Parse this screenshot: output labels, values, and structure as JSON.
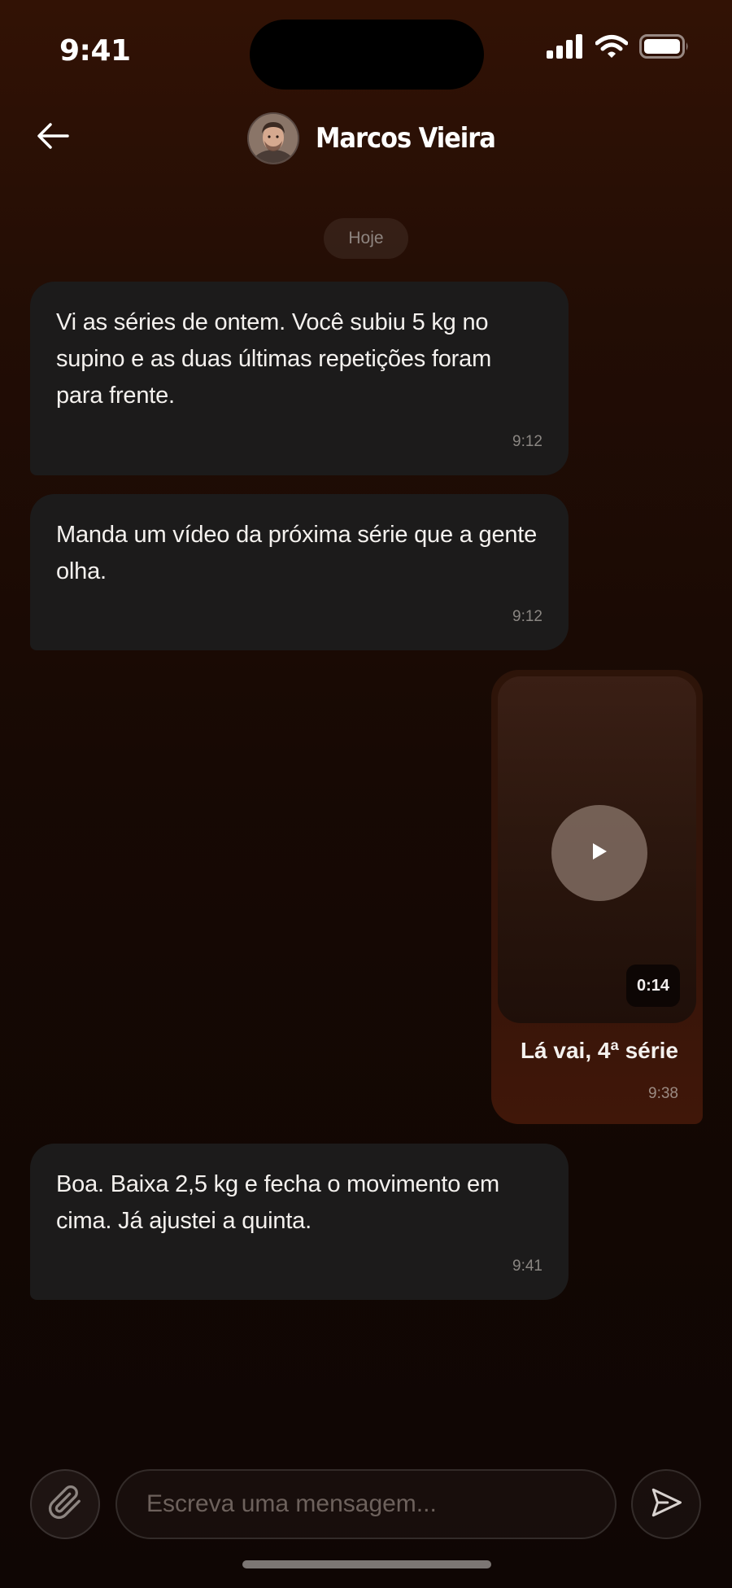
{
  "status_bar": {
    "time": "9:41"
  },
  "header": {
    "contact_name": "Marcos Vieira"
  },
  "chat": {
    "date_label": "Hoje",
    "messages": [
      {
        "direction": "incoming",
        "text": "Vi as séries de ontem. Você subiu 5 kg no supino e as duas últimas repetições foram para frente.",
        "time": "9:12"
      },
      {
        "direction": "incoming",
        "text": "Manda um vídeo da próxima série que a gente olha.",
        "time": "9:12"
      },
      {
        "direction": "outgoing",
        "type": "video",
        "duration": "0:14",
        "caption": "Lá vai, 4ª série",
        "time": "9:38"
      },
      {
        "direction": "incoming",
        "text": "Boa. Baixa 2,5 kg e fecha o movimento em cima. Já ajustei a quinta.",
        "time": "9:41"
      }
    ]
  },
  "composer": {
    "placeholder": "Escreva uma mensagem..."
  },
  "icons": {
    "back": "arrow-left-icon",
    "attach": "paperclip-icon",
    "send": "send-icon",
    "play": "play-icon"
  }
}
